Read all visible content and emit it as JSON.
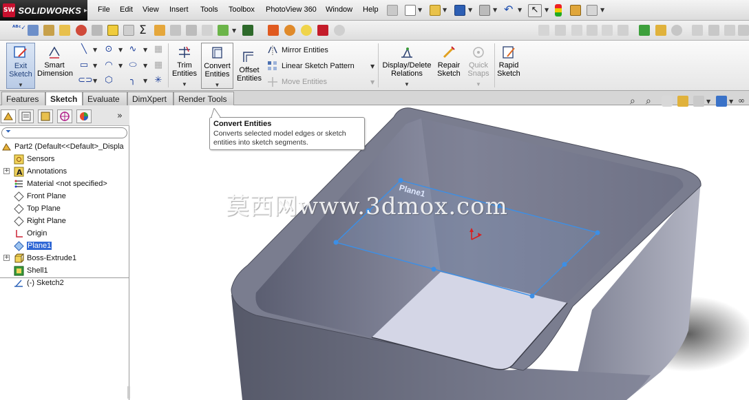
{
  "app": {
    "brand": "SOLIDWORKS",
    "brand_badge": "SW"
  },
  "menu": {
    "items": [
      "File",
      "Edit",
      "View",
      "Insert",
      "Tools",
      "Toolbox",
      "PhotoView 360",
      "Window",
      "Help"
    ]
  },
  "command_manager": {
    "exit_sketch": "Exit\nSketch",
    "smart_dimension": "Smart\nDimension",
    "trim_entities": "Trim\nEntities",
    "convert_entities": "Convert\nEntities",
    "offset_entities": "Offset\nEntities",
    "mirror_entities": "Mirror Entities",
    "linear_sketch_pattern": "Linear Sketch Pattern",
    "move_entities": "Move Entities",
    "display_delete_relations": "Display/Delete\nRelations",
    "repair_sketch": "Repair\nSketch",
    "quick_snaps": "Quick\nSnaps",
    "rapid_sketch": "Rapid\nSketch"
  },
  "tabs": [
    "Features",
    "Sketch",
    "Evaluate",
    "DimXpert",
    "Render Tools"
  ],
  "active_tab": "Sketch",
  "tree": {
    "root": "Part2  (Default<<Default>_Displa",
    "items": [
      {
        "label": "Sensors"
      },
      {
        "label": "Annotations"
      },
      {
        "label": "Material <not specified>"
      },
      {
        "label": "Front Plane"
      },
      {
        "label": "Top Plane"
      },
      {
        "label": "Right Plane"
      },
      {
        "label": "Origin"
      },
      {
        "label": "Plane1"
      },
      {
        "label": "Boss-Extrude1"
      },
      {
        "label": "Shell1"
      },
      {
        "label": "(-) Sketch2"
      }
    ],
    "expand_symbol": "+",
    "collapse_arrows": "»"
  },
  "tooltip": {
    "title": "Convert Entities",
    "body": "Converts selected model edges or sketch entities into sketch segments."
  },
  "viewport": {
    "plane_label": "Plane1",
    "watermark": "莫西网www.3dmox.com"
  },
  "colors": {
    "sketch_blue": "#3c8fe6",
    "selection_blue": "#3168d5",
    "model_dark": "#6c6f80",
    "model_floor": "#d4d6e6",
    "logo_red": "#c8102e"
  }
}
